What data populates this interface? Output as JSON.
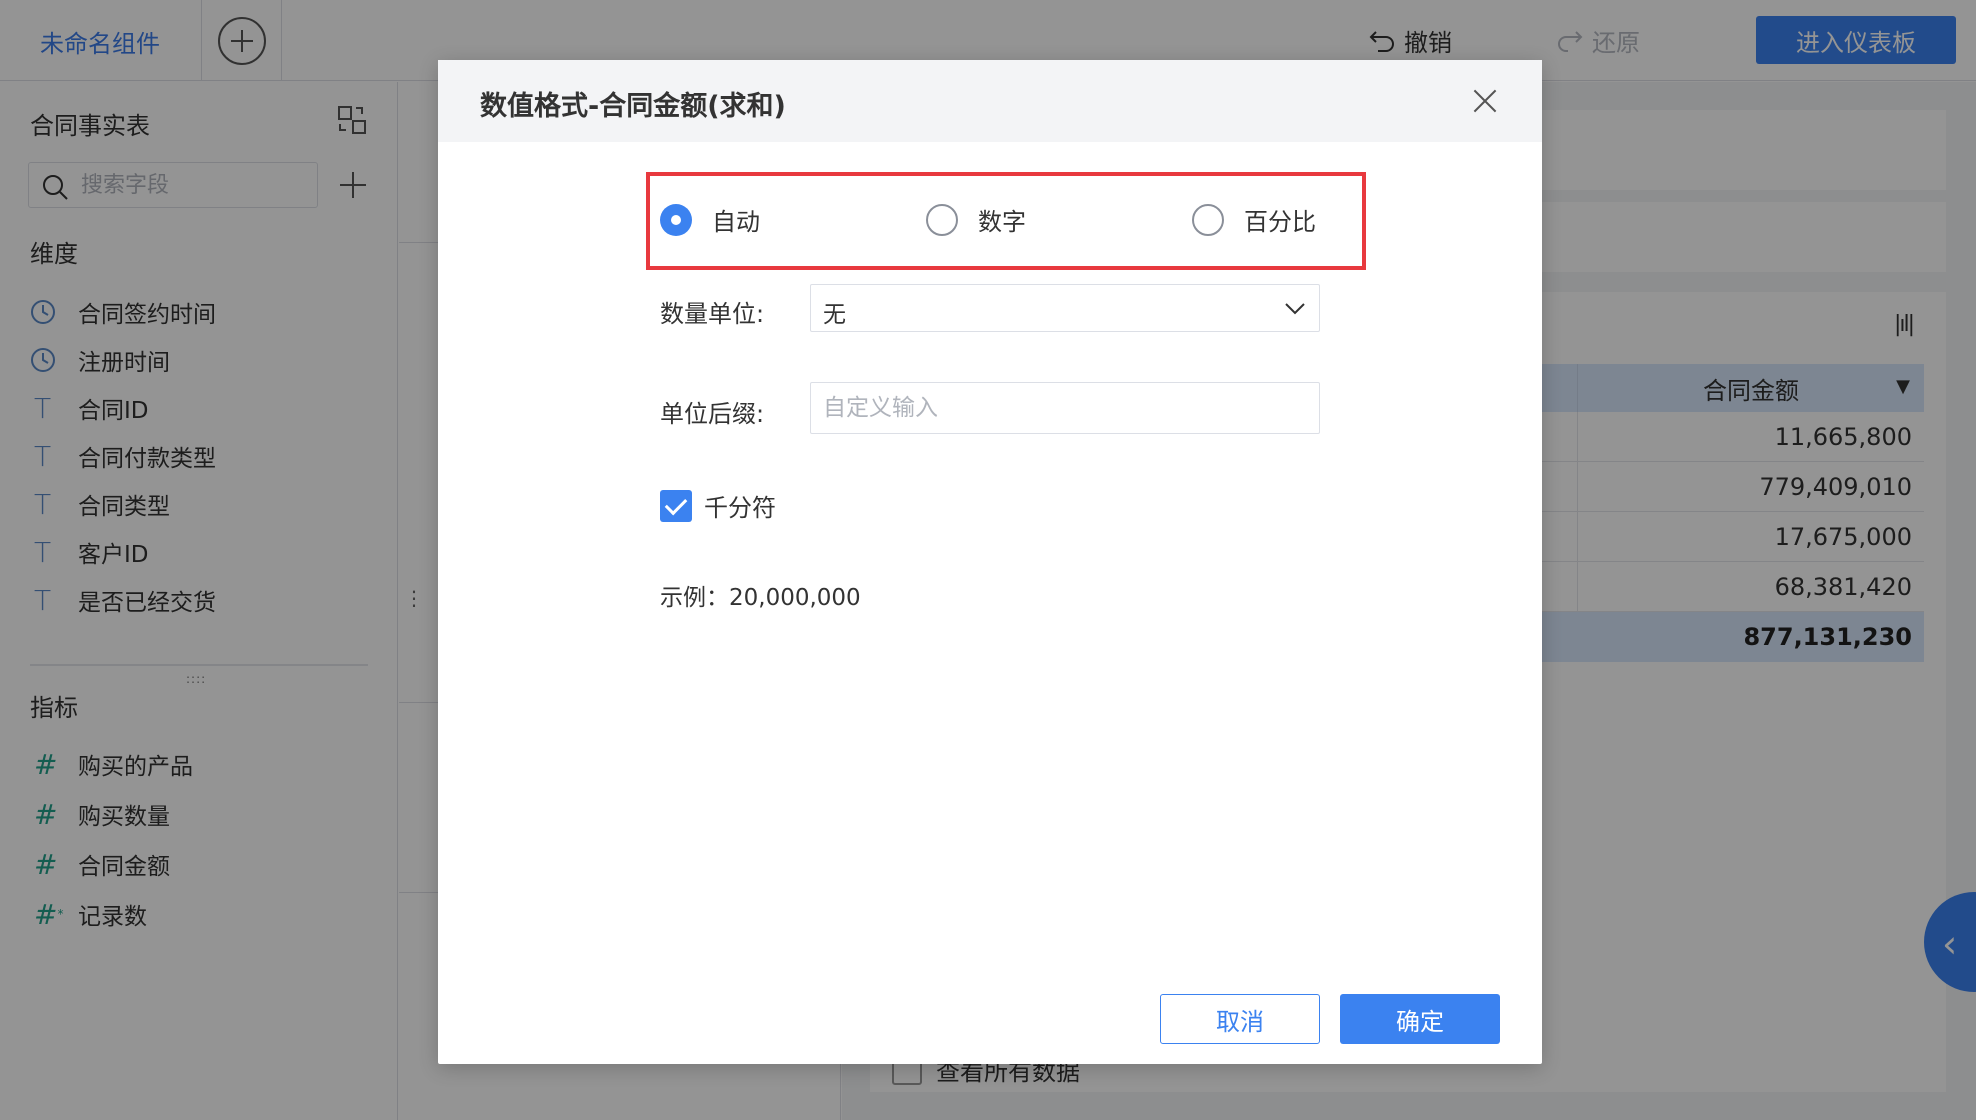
{
  "topbar": {
    "widget_name": "未命名组件",
    "undo_label": "撤销",
    "redo_label": "还原",
    "enter_dashboard_label": "进入仪表板"
  },
  "left_panel": {
    "table_name": "合同事实表",
    "search_placeholder": "搜索字段",
    "dimensions_title": "维度",
    "dimensions": [
      {
        "icon": "clock-icon",
        "label": "合同签约时间"
      },
      {
        "icon": "clock-icon",
        "label": "注册时间"
      },
      {
        "icon": "text-type-icon",
        "label": "合同ID"
      },
      {
        "icon": "text-type-icon",
        "label": "合同付款类型"
      },
      {
        "icon": "text-type-icon",
        "label": "合同类型"
      },
      {
        "icon": "text-type-icon",
        "label": "客户ID"
      },
      {
        "icon": "text-type-icon",
        "label": "是否已经交货"
      }
    ],
    "measures_title": "指标",
    "measures": [
      {
        "icon": "number-type-icon",
        "label": "购买的产品"
      },
      {
        "icon": "number-type-icon",
        "label": "购买数量"
      },
      {
        "icon": "number-type-icon",
        "label": "合同金额"
      },
      {
        "icon": "record-count-icon",
        "label": "记录数"
      }
    ]
  },
  "preview": {
    "column_header": "合同金额",
    "rows": [
      "11,665,800",
      "779,409,010",
      "17,675,000",
      "68,381,420"
    ],
    "total": "877,131,230",
    "view_all_label": "查看所有数据"
  },
  "modal": {
    "title": "数值格式-合同金额(求和)",
    "format_options": [
      "自动",
      "数字",
      "百分比"
    ],
    "selected_format": "自动",
    "unit_label": "数量单位:",
    "unit_value": "无",
    "suffix_label": "单位后缀:",
    "suffix_placeholder": "自定义输入",
    "suffix_value": "",
    "thousand_separator_label": "千分符",
    "thousand_separator_checked": true,
    "example_text": "示例：20,000,000",
    "cancel_label": "取消",
    "ok_label": "确定"
  },
  "colors": {
    "accent": "#3b82f0",
    "highlight_border": "#e8393e"
  }
}
